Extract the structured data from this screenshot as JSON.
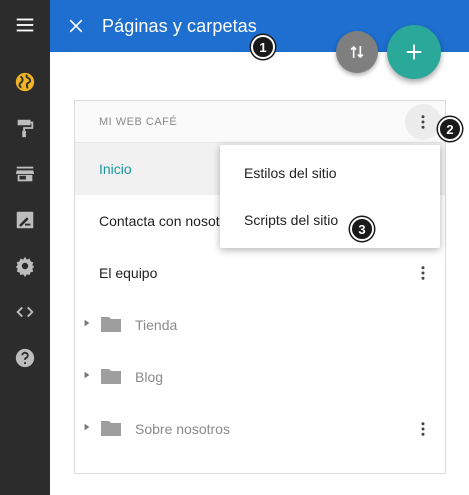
{
  "header": {
    "title": "Páginas y carpetas",
    "color": "#1e6fd0"
  },
  "callouts": [
    "1",
    "2",
    "3"
  ],
  "rail": {
    "items": [
      {
        "icon": "hamburger-menu-icon"
      },
      {
        "icon": "globe-icon",
        "active": true
      },
      {
        "icon": "paint-roller-icon"
      },
      {
        "icon": "store-icon"
      },
      {
        "icon": "edit-signature-icon"
      },
      {
        "icon": "gear-icon"
      },
      {
        "icon": "code-icon"
      },
      {
        "icon": "help-icon"
      }
    ]
  },
  "site": {
    "name": "MI WEB CAFÉ"
  },
  "pages": [
    {
      "label": "Inicio",
      "active": true
    },
    {
      "label": "Contacta con nosotros"
    },
    {
      "label": "El equipo"
    }
  ],
  "folders": [
    {
      "label": "Tienda"
    },
    {
      "label": "Blog"
    },
    {
      "label": "Sobre nosotros"
    }
  ],
  "menu": {
    "items": [
      {
        "label": "Estilos del sitio"
      },
      {
        "label": "Scripts del sitio"
      }
    ]
  },
  "colors": {
    "accent_teal": "#2aa89a",
    "active_text": "#1a9a9f",
    "rail_bg": "#2c2c2c",
    "globe_active": "#f0b323"
  }
}
